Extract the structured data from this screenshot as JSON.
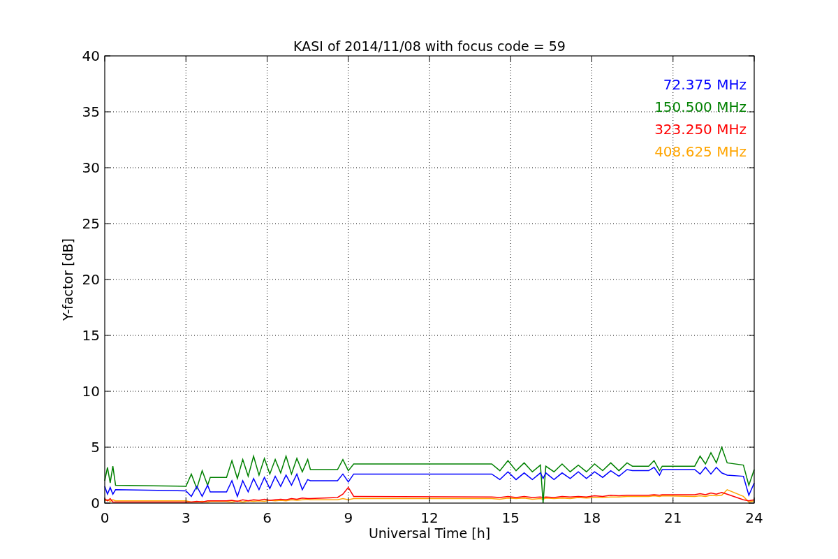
{
  "figure": {
    "chart_data": {
      "type": "line",
      "title": "KASI of 2014/11/08 with focus code = 59",
      "xlabel": "Universal Time [h]",
      "ylabel": "Y-factor [dB]",
      "xlim": [
        0,
        24
      ],
      "ylim": [
        0,
        40
      ],
      "xticks": [
        0,
        3,
        6,
        9,
        12,
        15,
        18,
        21,
        24
      ],
      "yticks": [
        0,
        5,
        10,
        15,
        20,
        25,
        30,
        35,
        40
      ],
      "grid": true,
      "x": [
        0,
        0.1,
        0.2,
        0.3,
        0.4,
        3.0,
        3.2,
        3.4,
        3.6,
        3.8,
        3.9,
        4.5,
        4.7,
        4.9,
        5.1,
        5.3,
        5.5,
        5.7,
        5.9,
        6.1,
        6.3,
        6.5,
        6.7,
        6.9,
        7.1,
        7.3,
        7.5,
        7.6,
        8.6,
        8.8,
        9.0,
        9.2,
        14.3,
        14.6,
        14.9,
        15.2,
        15.5,
        15.8,
        16.1,
        16.2,
        16.3,
        16.6,
        16.9,
        17.2,
        17.5,
        17.8,
        18.1,
        18.4,
        18.7,
        19.0,
        19.3,
        19.5,
        20.1,
        20.3,
        20.5,
        20.6,
        21.8,
        22.0,
        22.2,
        22.4,
        22.6,
        22.8,
        23.0,
        23.6,
        23.8,
        24.0
      ],
      "series": [
        {
          "name": "72.375 MHz",
          "color": "#0000ff",
          "values": [
            1.5,
            0.8,
            1.4,
            0.8,
            1.2,
            1.1,
            0.6,
            1.5,
            0.6,
            1.6,
            1.0,
            1.0,
            2.0,
            0.6,
            2.0,
            1.0,
            2.2,
            1.2,
            2.3,
            1.3,
            2.4,
            1.5,
            2.5,
            1.6,
            2.6,
            1.2,
            2.1,
            2.0,
            2.0,
            2.6,
            1.9,
            2.6,
            2.6,
            2.1,
            2.8,
            2.1,
            2.7,
            2.1,
            2.7,
            2.2,
            2.7,
            2.1,
            2.7,
            2.2,
            2.8,
            2.2,
            2.8,
            2.3,
            2.9,
            2.4,
            3.0,
            2.9,
            2.9,
            3.2,
            2.5,
            3.0,
            3.0,
            2.6,
            3.2,
            2.6,
            3.2,
            2.7,
            2.5,
            2.4,
            0.7,
            1.8
          ]
        },
        {
          "name": "150.500 MHz",
          "color": "#008000",
          "values": [
            2.0,
            3.2,
            1.8,
            3.3,
            1.6,
            1.5,
            2.6,
            1.3,
            2.9,
            1.6,
            2.3,
            2.3,
            3.8,
            2.2,
            3.9,
            2.4,
            4.2,
            2.5,
            4.0,
            2.6,
            3.9,
            2.7,
            4.2,
            2.6,
            4.0,
            2.8,
            3.9,
            3.0,
            3.0,
            3.9,
            2.9,
            3.5,
            3.5,
            2.9,
            3.8,
            2.9,
            3.6,
            2.8,
            3.4,
            0,
            3.3,
            2.8,
            3.5,
            2.8,
            3.4,
            2.8,
            3.5,
            2.9,
            3.6,
            2.9,
            3.6,
            3.3,
            3.3,
            3.8,
            2.9,
            3.3,
            3.3,
            4.2,
            3.5,
            4.5,
            3.6,
            5.0,
            3.6,
            3.4,
            1.6,
            3.0
          ]
        },
        {
          "name": "323.250 MHz",
          "color": "#ff0000",
          "values": [
            0.4,
            0.2,
            0.4,
            0.1,
            0.1,
            0.1,
            0.1,
            0.15,
            0.1,
            0.2,
            0.2,
            0.2,
            0.25,
            0.15,
            0.3,
            0.2,
            0.3,
            0.25,
            0.35,
            0.25,
            0.3,
            0.35,
            0.3,
            0.4,
            0.35,
            0.45,
            0.4,
            0.4,
            0.5,
            0.8,
            1.4,
            0.6,
            0.55,
            0.5,
            0.6,
            0.5,
            0.6,
            0.5,
            0.55,
            0.5,
            0.55,
            0.5,
            0.6,
            0.55,
            0.6,
            0.55,
            0.65,
            0.6,
            0.7,
            0.65,
            0.7,
            0.7,
            0.7,
            0.75,
            0.7,
            0.75,
            0.75,
            0.85,
            0.75,
            0.9,
            0.8,
            0.95,
            0.8,
            0.3,
            0.2,
            0.3
          ]
        },
        {
          "name": "408.625 MHz",
          "color": "#ffa500",
          "values": [
            0.2,
            0.3,
            0.15,
            0.3,
            0.2,
            0.2,
            0.1,
            0.1,
            0.15,
            0.1,
            0.15,
            0.15,
            0.1,
            0.2,
            0.1,
            0.2,
            0.15,
            0.2,
            0.15,
            0.25,
            0.2,
            0.25,
            0.2,
            0.3,
            0.25,
            0.3,
            0.35,
            0.3,
            0.3,
            0.4,
            0.3,
            0.4,
            0.4,
            0.35,
            0.45,
            0.4,
            0.45,
            0.35,
            0.4,
            0.35,
            0.45,
            0.4,
            0.45,
            0.4,
            0.5,
            0.45,
            0.5,
            0.5,
            0.55,
            0.55,
            0.6,
            0.6,
            0.6,
            0.65,
            0.6,
            0.65,
            0.6,
            0.65,
            0.6,
            0.7,
            0.65,
            0.7,
            1.2,
            0.6,
            0.1,
            0.2
          ]
        }
      ]
    }
  }
}
